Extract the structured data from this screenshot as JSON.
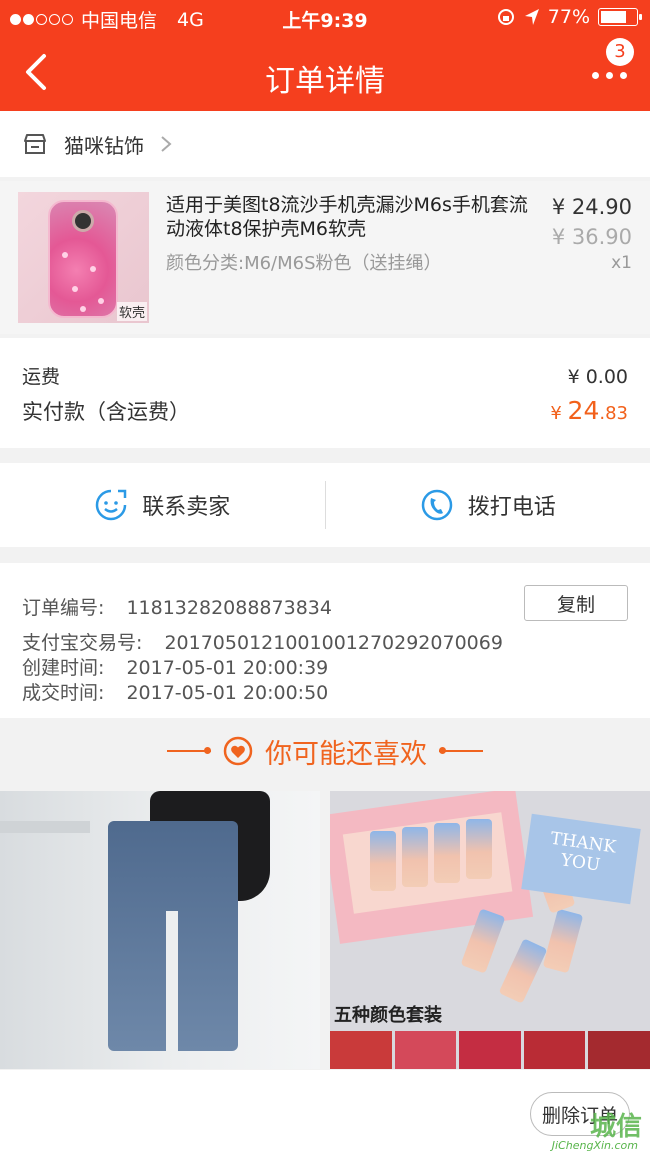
{
  "status_bar": {
    "carrier": "中国电信",
    "network": "4G",
    "time": "上午9:39",
    "battery": "77%",
    "battery_level": 0.77
  },
  "nav": {
    "title": "订单详情",
    "badge": "3"
  },
  "shop": {
    "name": "猫咪钻饰"
  },
  "product": {
    "title": "适用于美图t8流沙手机壳漏沙M6s手机套流动液体t8保护壳M6软壳",
    "spec": "颜色分类:M6/M6S粉色（送挂绳）",
    "price": "¥ 24.90",
    "original_price": "¥ 36.90",
    "quantity": "x1",
    "image_tag": "软壳"
  },
  "totals": {
    "shipping_label": "运费",
    "shipping_value": "¥ 0.00",
    "paid_label": "实付款（含运费）",
    "paid_currency": "¥ ",
    "paid_int": "24",
    "paid_dec": ".83"
  },
  "contact": {
    "seller_label": "联系卖家",
    "phone_label": "拨打电话"
  },
  "order": {
    "id_label": "订单编号:",
    "id_value": "11813282088873834",
    "copy_label": "复制",
    "alipay_label": "支付宝交易号:",
    "alipay_value": "2017050121001001270292070069",
    "created_label": "创建时间:",
    "created_value": "2017-05-01 20:00:39",
    "deal_label": "成交时间:",
    "deal_value": "2017-05-01 20:00:50"
  },
  "recommend": {
    "title": "你可能还喜欢",
    "item2_card_text": "THANK YOU",
    "item2_caption": "五种颜色套装"
  },
  "footer": {
    "delete_label": "删除订单",
    "watermark_cn": "城信",
    "watermark_en": "JiChengXin.com"
  },
  "colors": {
    "accent": "#f53f1e",
    "price_highlight": "#f2611b",
    "recommend": "#f0641f"
  }
}
